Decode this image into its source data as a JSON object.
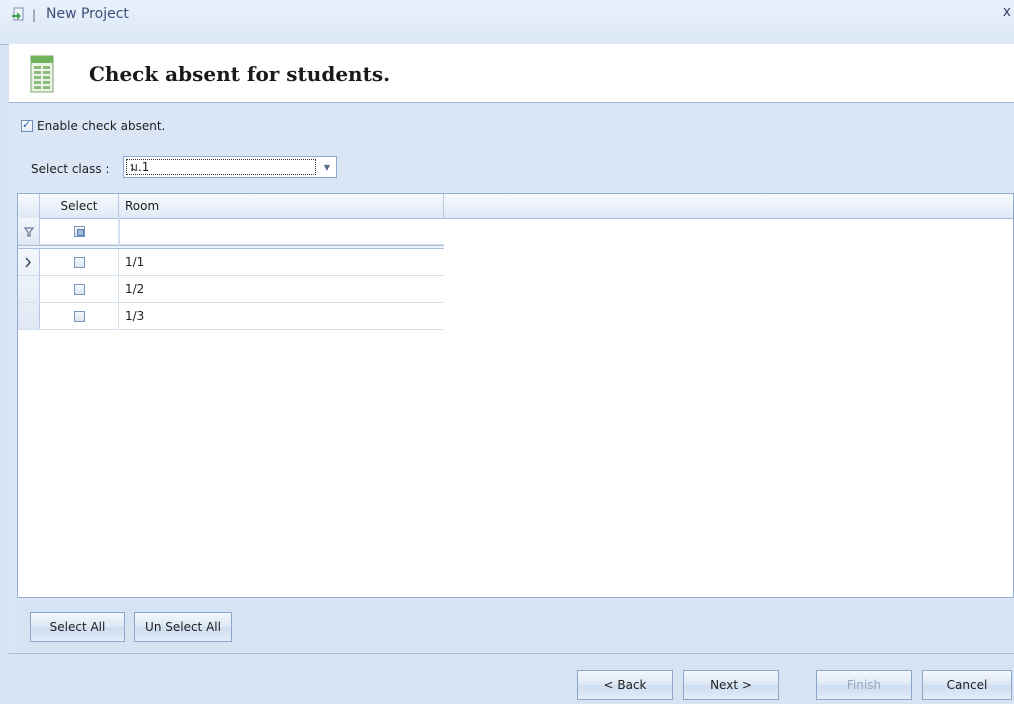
{
  "window": {
    "title": "New Project",
    "close_label": "x"
  },
  "header": {
    "title": "Check absent for students."
  },
  "options": {
    "enable_label": "Enable check absent.",
    "enable_checked": true,
    "class_label": "Select class :",
    "class_value": "ม.1"
  },
  "grid": {
    "columns": [
      "Select",
      "Room"
    ],
    "rows": [
      {
        "selected": false,
        "room": "1/1"
      },
      {
        "selected": false,
        "room": "1/2"
      },
      {
        "selected": false,
        "room": "1/3"
      }
    ]
  },
  "actions": {
    "select_all": "Select All",
    "unselect_all": "Un Select All"
  },
  "wizard": {
    "back": "< Back",
    "next": "Next >",
    "finish": "Finish",
    "cancel": "Cancel"
  },
  "icons": {
    "app": "new-project-icon",
    "header": "spreadsheet-icon",
    "filter": "filter-icon",
    "current_row": "row-pointer-icon"
  },
  "colors": {
    "accent": "#3b4f77",
    "panel": "#dae6f5",
    "border": "#94acd0"
  }
}
